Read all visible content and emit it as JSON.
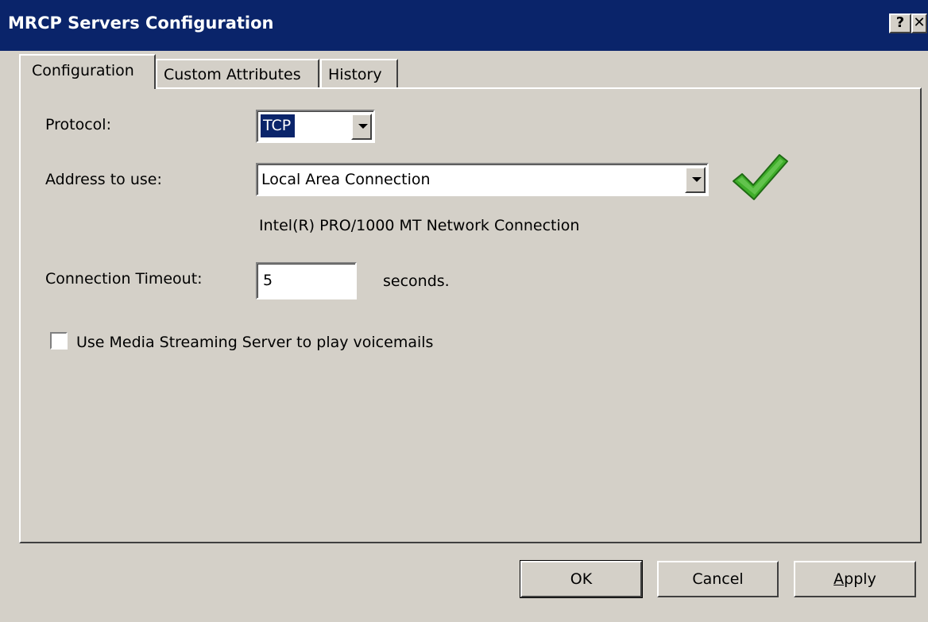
{
  "window": {
    "title": "MRCP Servers Configuration",
    "help_label": "?",
    "close_label": "✕"
  },
  "tabs": [
    {
      "label": "Configuration",
      "active": true
    },
    {
      "label": "Custom Attributes",
      "active": false
    },
    {
      "label": "History",
      "active": false
    }
  ],
  "form": {
    "protocol_label": "Protocol:",
    "protocol_value": "TCP",
    "address_label": "Address to use:",
    "address_value": "Local Area Connection",
    "adapter_description": "Intel(R) PRO/1000 MT Network Connection",
    "address_status_icon": "green-checkmark-icon",
    "timeout_label": "Connection Timeout:",
    "timeout_value": "5",
    "timeout_unit": "seconds.",
    "media_streaming_label": "Use Media Streaming Server to play voicemails",
    "media_streaming_checked": false
  },
  "buttons": {
    "ok": "OK",
    "cancel": "Cancel",
    "apply": "Apply"
  },
  "colors": {
    "titlebar": "#0a246a",
    "face": "#d4d0c8",
    "selection": "#0a246a",
    "check_green": "#3fae2a"
  }
}
